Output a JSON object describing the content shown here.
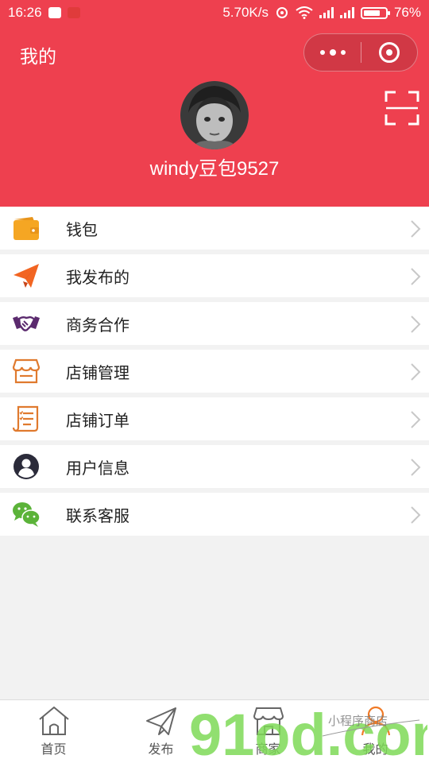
{
  "status_bar": {
    "time": "16:26",
    "network_speed": "5.70K/s",
    "battery_percent": "76%",
    "battery_level": 0.76
  },
  "header": {
    "title": "我的",
    "username": "windy豆包9527"
  },
  "menu": [
    {
      "label": "钱包",
      "icon": "wallet-icon",
      "color": "#f5a623"
    },
    {
      "label": "我发布的",
      "icon": "paper-plane-icon",
      "color": "#f26522"
    },
    {
      "label": "商务合作",
      "icon": "handshake-icon",
      "color": "#5b2a6e"
    },
    {
      "label": "店铺管理",
      "icon": "store-icon",
      "color": "#e07a2e"
    },
    {
      "label": "店铺订单",
      "icon": "order-list-icon",
      "color": "#e07a2e"
    },
    {
      "label": "用户信息",
      "icon": "user-icon",
      "color": "#2b2b3a"
    },
    {
      "label": "联系客服",
      "icon": "wechat-icon",
      "color": "#5bb339"
    }
  ],
  "tabbar": [
    {
      "label": "首页",
      "icon": "home-icon"
    },
    {
      "label": "发布",
      "icon": "send-icon"
    },
    {
      "label": "商家",
      "icon": "shop-icon"
    },
    {
      "label": "我的",
      "icon": "profile-icon",
      "active": true
    }
  ],
  "watermark": {
    "text": "91od.com",
    "subtext": "小程序商店"
  },
  "colors": {
    "primary": "#ee404f",
    "background": "#f2f2f2",
    "active_tab": "#f07a26"
  }
}
